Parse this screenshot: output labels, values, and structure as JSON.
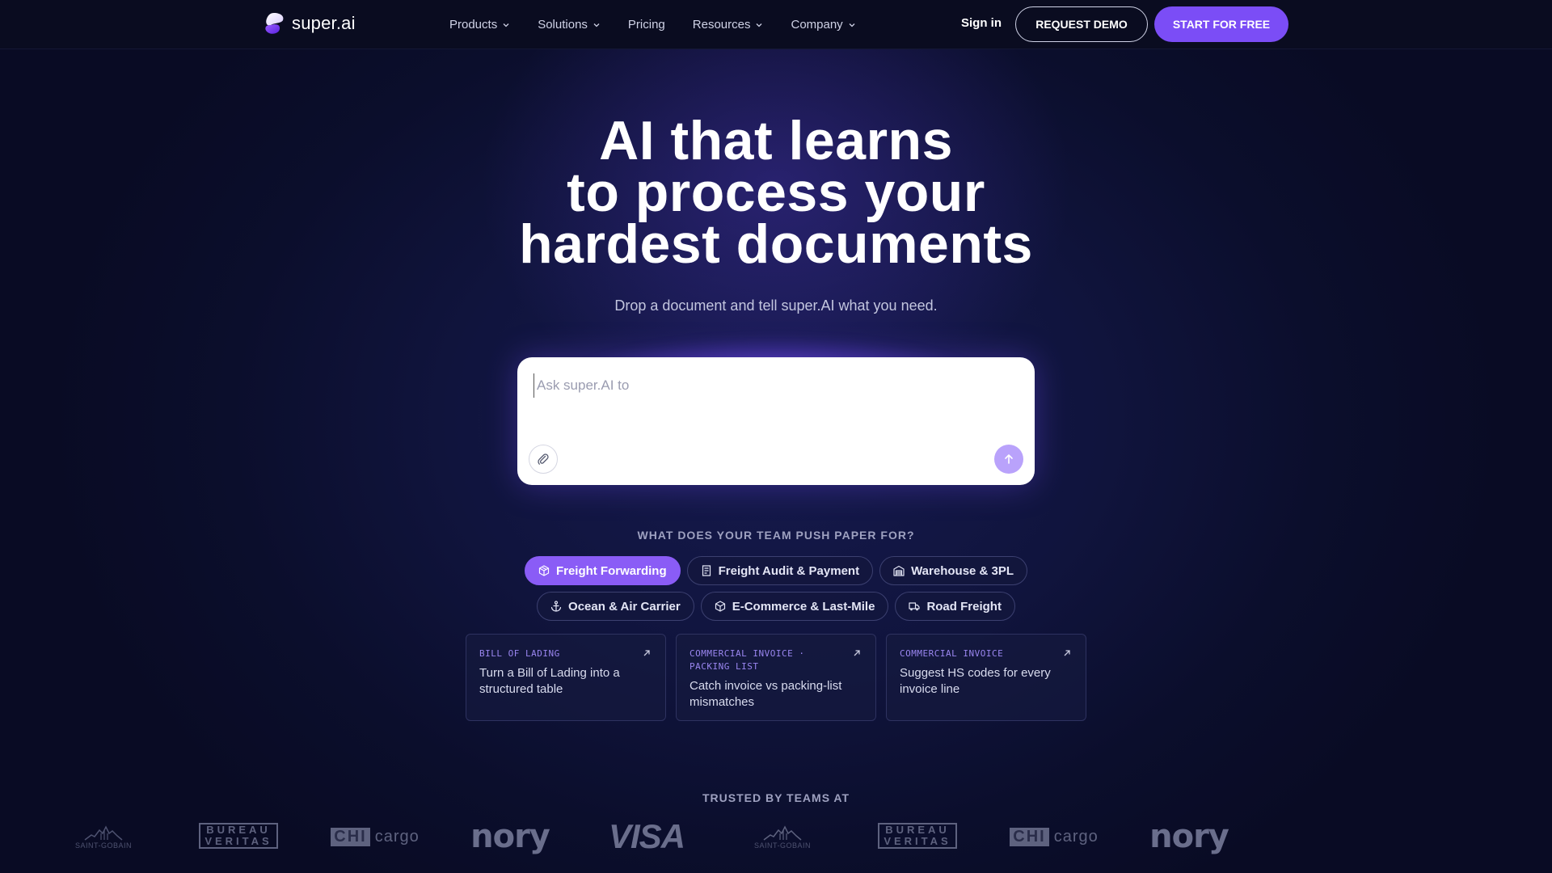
{
  "brand": {
    "name": "super.ai",
    "accent": "#7b4df6"
  },
  "nav": {
    "links": [
      {
        "label": "Products",
        "dropdown": true
      },
      {
        "label": "Solutions",
        "dropdown": true
      },
      {
        "label": "Pricing",
        "dropdown": false
      },
      {
        "label": "Resources",
        "dropdown": true
      },
      {
        "label": "Company",
        "dropdown": true
      }
    ],
    "sign_in": "Sign in",
    "request_demo": "REQUEST DEMO",
    "start_free": "START FOR FREE"
  },
  "hero": {
    "title_lines": [
      "AI that learns",
      "to process your",
      "hardest documents"
    ],
    "subtitle": "Drop a document and tell super.AI what you need."
  },
  "prompt": {
    "placeholder": "Ask super.AI to",
    "value": "",
    "attach_icon": "paperclip-icon",
    "send_icon": "arrow-up-icon"
  },
  "industries": {
    "question": "WHAT DOES YOUR TEAM PUSH PAPER FOR?",
    "selected": "Freight Forwarding",
    "row1": [
      {
        "label": "Freight Forwarding",
        "icon": "package-icon",
        "active": true
      },
      {
        "label": "Freight Audit & Payment",
        "icon": "receipt-icon",
        "active": false
      },
      {
        "label": "Warehouse & 3PL",
        "icon": "warehouse-icon",
        "active": false
      }
    ],
    "row2": [
      {
        "label": "Ocean & Air Carrier",
        "icon": "anchor-icon",
        "active": false
      },
      {
        "label": "E-Commerce & Last-Mile",
        "icon": "box-icon",
        "active": false
      },
      {
        "label": "Road Freight",
        "icon": "truck-icon",
        "active": false
      }
    ]
  },
  "cards": [
    {
      "tag": "BILL OF LADING",
      "text": "Turn a Bill of Lading into a structured table"
    },
    {
      "tag": "COMMERCIAL INVOICE · PACKING LIST",
      "text": "Catch invoice vs packing-list mismatches"
    },
    {
      "tag": "COMMERCIAL INVOICE",
      "text": "Suggest HS codes for every invoice line"
    }
  ],
  "trusted": {
    "heading": "TRUSTED BY TEAMS AT",
    "logos": {
      "saint_gobain": "SAINT-GOBAIN",
      "bureau": "BUREAU",
      "veritas": "VERITAS",
      "chi": "CHI",
      "cargo": "cargo",
      "nory": "nory",
      "visa": "VISA"
    }
  }
}
